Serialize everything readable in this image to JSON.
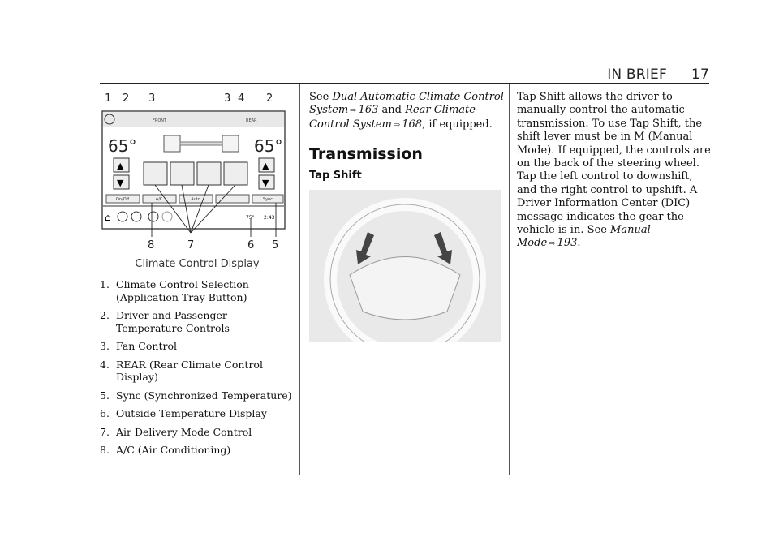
{
  "header": {
    "section": "IN BRIEF",
    "page_number": "17"
  },
  "figure1": {
    "callouts_top": [
      "1",
      "2",
      "3",
      "3",
      "4",
      "2"
    ],
    "callouts_bottom": [
      "8",
      "7",
      "6",
      "5"
    ],
    "screen": {
      "tab_front": "FRONT",
      "tab_rear": "REAR",
      "left_temp": "65°",
      "right_temp": "65°",
      "buttons": [
        "On/Off",
        "A/C",
        "Auto",
        "",
        "Sync"
      ],
      "outside_temp": "75°",
      "time": "2:43"
    },
    "caption": "Climate Control Display"
  },
  "legend": [
    {
      "n": "1.",
      "text": "Climate Control Selection (Application Tray Button)"
    },
    {
      "n": "2.",
      "text": "Driver and Passenger Temperature Controls"
    },
    {
      "n": "3.",
      "text": "Fan Control"
    },
    {
      "n": "4.",
      "text": "REAR (Rear Climate Control Display)"
    },
    {
      "n": "5.",
      "text": "Sync (Synchronized Temperature)"
    },
    {
      "n": "6.",
      "text": "Outside Temperature Display"
    },
    {
      "n": "7.",
      "text": "Air Delivery Mode Control"
    },
    {
      "n": "8.",
      "text": "A/C (Air Conditioning)"
    }
  ],
  "col2": {
    "see": "See",
    "ref1": "Dual Automatic Climate Control System",
    "ref1_page": "163",
    "and": "and",
    "ref2": "Rear Climate Control System",
    "ref2_page": "168",
    "tail": ", if equipped.",
    "heading": "Transmission",
    "subheading": "Tap Shift"
  },
  "col3": {
    "body": "Tap Shift allows the driver to manually control the automatic transmission. To use Tap Shift, the shift lever must be in M (Manual Mode). If equipped, the controls are on the back of the steering wheel. Tap the left control to downshift, and the right control to upshift. A Driver Information Center (DIC) message indicates the gear the vehicle is in.",
    "see": "See",
    "ref": "Manual Mode",
    "ref_page": "193",
    "end": "."
  }
}
